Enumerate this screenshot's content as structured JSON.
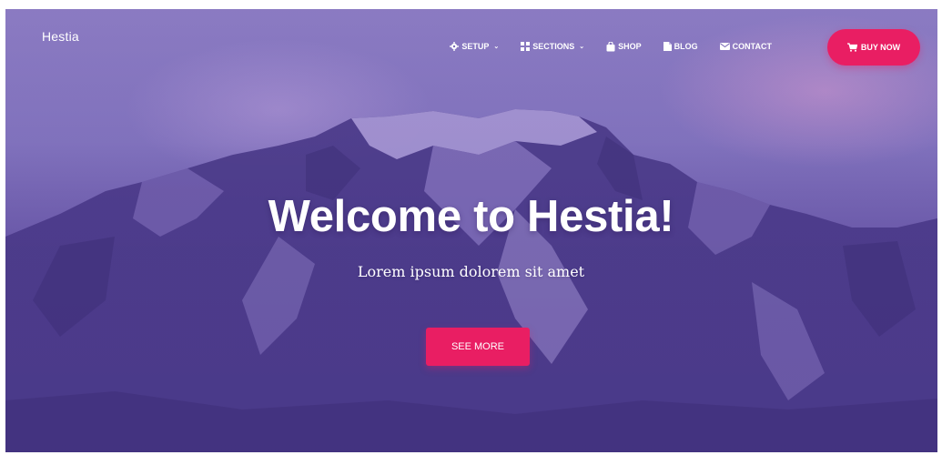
{
  "brand": "Hestia",
  "nav": {
    "items": [
      {
        "label": "SETUP",
        "icon": "gear-icon",
        "has_dropdown": true
      },
      {
        "label": "SECTIONS",
        "icon": "grid-icon",
        "has_dropdown": true
      },
      {
        "label": "SHOP",
        "icon": "bag-icon",
        "has_dropdown": false
      },
      {
        "label": "BLOG",
        "icon": "document-icon",
        "has_dropdown": false
      },
      {
        "label": "CONTACT",
        "icon": "envelope-icon",
        "has_dropdown": false
      }
    ],
    "buy_now": "BUY NOW",
    "caret": "⌄"
  },
  "hero": {
    "title": "Welcome to Hestia!",
    "subtitle": "Lorem ipsum dolorem sit amet",
    "cta": "SEE MORE"
  },
  "colors": {
    "accent": "#e91e63",
    "overlay": "#6c5aa8",
    "text": "#ffffff"
  }
}
